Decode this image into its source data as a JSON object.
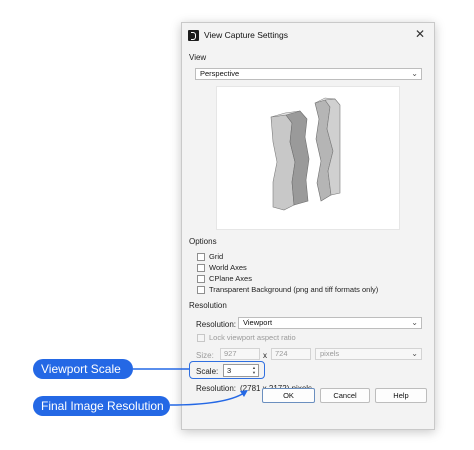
{
  "window": {
    "title": "View Capture Settings",
    "close_glyph": "✕"
  },
  "view": {
    "section_label": "View",
    "selected": "Perspective"
  },
  "options": {
    "section_label": "Options",
    "checkboxes": [
      {
        "label": "Grid",
        "checked": false
      },
      {
        "label": "World Axes",
        "checked": false
      },
      {
        "label": "CPlane Axes",
        "checked": false
      },
      {
        "label": "Transparent Background (png and tiff formats only)",
        "checked": false
      }
    ]
  },
  "resolution": {
    "section_label": "Resolution",
    "resolution_label": "Resolution:",
    "resolution_value": "Viewport",
    "lock_label": "Lock viewport aspect ratio",
    "size_label": "Size:",
    "width": "927",
    "x_sep": "x",
    "height": "724",
    "unit": "pixels",
    "scale_label": "Scale:",
    "scale_value": "3",
    "computed_label": "Resolution:",
    "computed_value": "(2781 x 2172) pixels"
  },
  "buttons": {
    "ok": "OK",
    "cancel": "Cancel",
    "help": "Help"
  },
  "callouts": {
    "viewport_scale": "Viewport Scale",
    "final_resolution": "Final Image Resolution"
  },
  "colors": {
    "accent": "#2468e5",
    "dialog_bg": "#f3f3f3"
  }
}
